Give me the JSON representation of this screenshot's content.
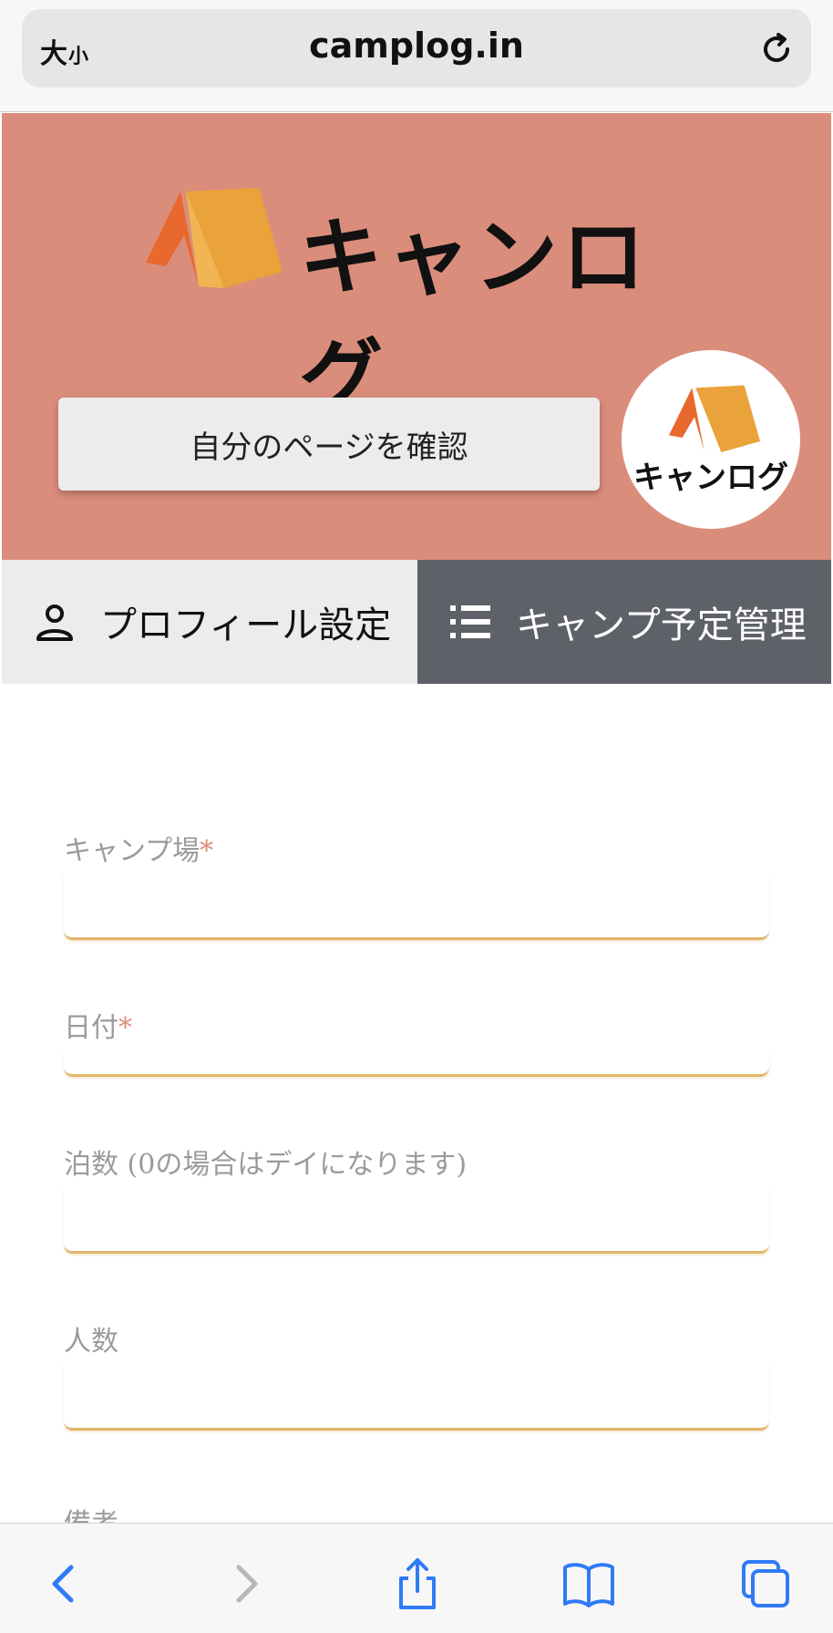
{
  "browser": {
    "text_size_label": "大",
    "text_size_small": "小",
    "url": "camplog.in"
  },
  "header": {
    "logo_text": "キャンログ",
    "my_page_button": "自分のページを確認",
    "avatar_text": "キャンログ"
  },
  "tabs": [
    {
      "label": "プロフィール設定",
      "icon": "person-icon",
      "active": false
    },
    {
      "label": "キャンプ予定管理",
      "icon": "list-icon",
      "active": true
    }
  ],
  "form": {
    "campsite_label": "キャンプ場",
    "date_label": "日付",
    "nights_label": "泊数 (0の場合はデイになります)",
    "people_label": "人数",
    "notes_label": "備考",
    "required_mark": "*"
  },
  "colors": {
    "header_bg": "#db8d7c",
    "active_tab_bg": "#5e6167",
    "input_underline": "#e2b56a",
    "tent_orange": "#e8682e",
    "tent_yellow": "#eaa23a",
    "toolbar_blue": "#2f7bf6"
  },
  "toolbar": {
    "icons": [
      "back-icon",
      "forward-icon",
      "share-icon",
      "bookmarks-icon",
      "tabs-icon"
    ]
  }
}
